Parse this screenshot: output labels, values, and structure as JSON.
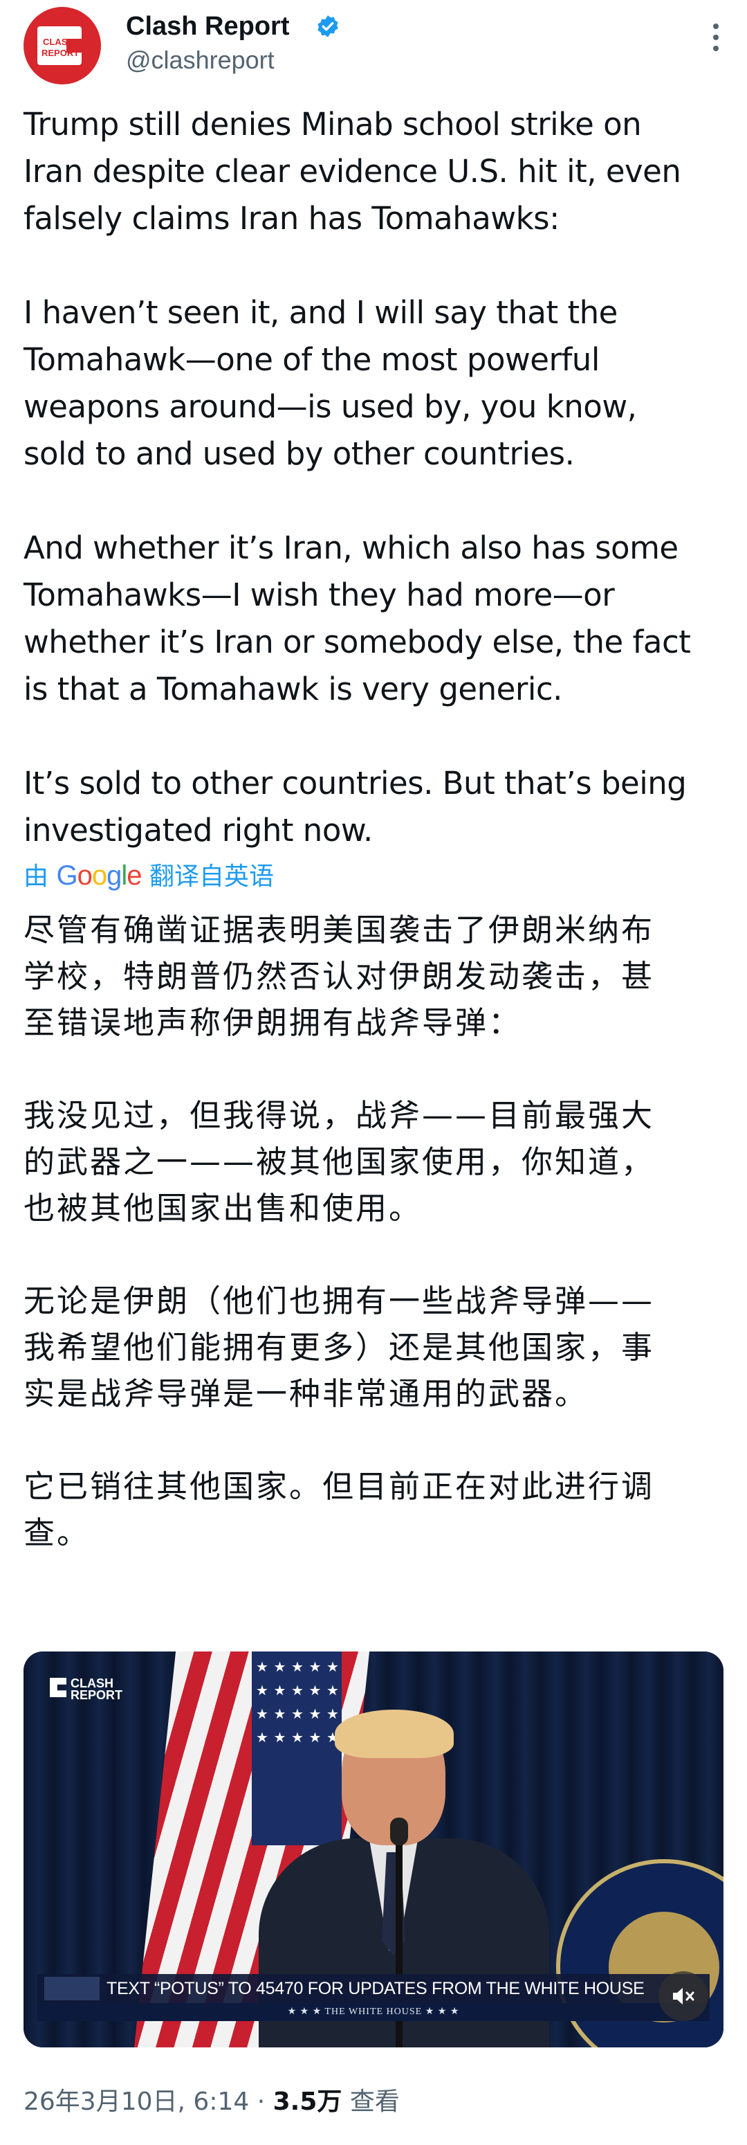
{
  "author": {
    "name": "Clash Report",
    "handle": "@clashreport",
    "avatar_logo_top": "CLASH",
    "avatar_logo_bottom": "REPORT",
    "verified_color": "#1d9bf0"
  },
  "tweet": {
    "text": "Trump still denies Minab school strike on\nIran despite clear evidence U.S. hit it, even\nfalsely claims Iran has Tomahawks:\n\nI haven’t seen it, and I will say that the\nTomahawk—one of the most powerful\nweapons around—is used by, you know,\nsold to and used by other countries.\n\nAnd whether it’s Iran, which also has some\nTomahawks—I wish they had more—or\nwhether it’s Iran or somebody else, the fact\nis that a Tomahawk is very generic.\n\nIt’s sold to other countries. But that’s being\ninvestigated right now.",
    "translate_prefix": "由",
    "translate_brand": "Google",
    "translate_suffix": "翻译自英语",
    "translated_text": "尽管有确凿证据表明美国袭击了伊朗米纳布\n学校，特朗普仍然否认对伊朗发动袭击，甚\n至错误地声称伊朗拥有战斧导弹：\n\n我没见过，但我得说，战斧——目前最强大\n的武器之一——被其他国家使用，你知道，\n也被其他国家出售和使用。\n\n无论是伊朗（他们也拥有一些战斧导弹——\n我希望他们能拥有更多）还是其他国家，事\n实是战斧导弹是一种非常通用的武器。\n\n它已销往其他国家。但目前正在对此进行调\n查。"
  },
  "media": {
    "watermark_top": "CLASH",
    "watermark_bottom": "REPORT",
    "ticker_text": "TEXT “POTUS” TO 45470 FOR UPDATES FROM THE WHITE HOUSE",
    "ticker_bottom": "★ ★ ★   THE WHITE HOUSE   ★ ★ ★",
    "mute_icon": "speaker-muted-icon"
  },
  "meta": {
    "timestamp": "26年3月10日, 6:14 · ",
    "views": "3.5万",
    "views_label": " 查看"
  },
  "icons": {
    "more": "more-vertical-icon",
    "verified": "verified-badge-icon"
  }
}
